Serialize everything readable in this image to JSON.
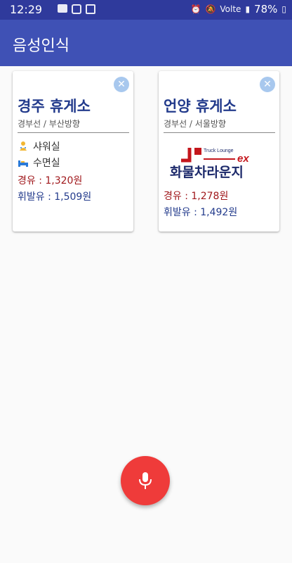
{
  "status_bar": {
    "time": "12:29",
    "battery": "78%",
    "network": "Volte"
  },
  "app_bar": {
    "title": "음성인식"
  },
  "cards": [
    {
      "name": "경주 휴게소",
      "route": "경부선 / 부산방향",
      "facilities": [
        "샤워실",
        "수면실"
      ],
      "diesel": "경유 : 1,320원",
      "gasoline": "휘발유 : 1,509원"
    },
    {
      "name": "언양 휴게소",
      "route": "경부선 / 서울방향",
      "logo": {
        "top": "Truck Lounge",
        "brand": "ex",
        "main": "화물차라운지"
      },
      "diesel": "경유 : 1,278원",
      "gasoline": "휘발유 : 1,492원"
    }
  ],
  "fab": {
    "icon": "microphone-icon",
    "color": "#ef3b3a"
  },
  "colors": {
    "appbar": "#3f51b5",
    "statusbar": "#2f3a9c",
    "title_blue": "#233b8c",
    "price_red": "#a0181c"
  }
}
